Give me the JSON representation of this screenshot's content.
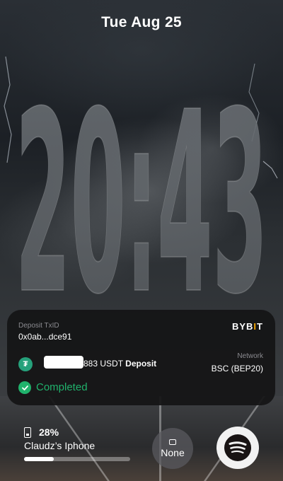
{
  "lockscreen": {
    "date": "Tue Aug 25",
    "time": "20:43"
  },
  "activity": {
    "txid_label": "Deposit TxID",
    "txid_value": "0x0ab...dce91",
    "brand": "BYB",
    "brand_bar": "I",
    "brand_end": "T",
    "amount_text": "883 USDT",
    "deposit_label": "Deposit",
    "network_label": "Network",
    "network_value": "BSC (BEP20)",
    "status": "Completed",
    "coin_symbol": "₮",
    "colors": {
      "success": "#20b26c",
      "tether": "#26a17b",
      "brand_accent": "#f7a600"
    }
  },
  "battery": {
    "percent_text": "28%",
    "level": 0.28,
    "device_name": "Claudz’s Iphone"
  },
  "controls": {
    "focus_label": "None",
    "music_app_icon": "spotify-icon"
  }
}
